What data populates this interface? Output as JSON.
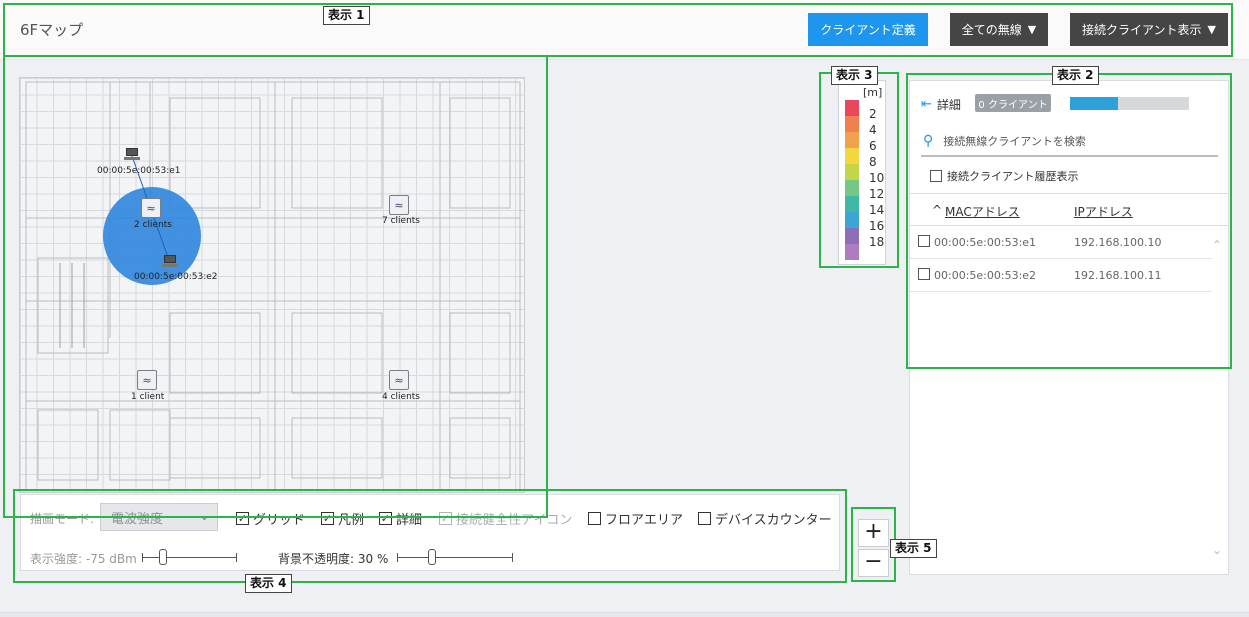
{
  "header": {
    "map_title": "6Fマップ",
    "client_define_button": "クライアント定義",
    "wireless_filter_button": "全ての無線",
    "client_display_button": "接続クライアント表示",
    "dropdown_caret": "▼"
  },
  "map": {
    "access_points": [
      {
        "label": "2 clients"
      },
      {
        "label": "7 clients"
      },
      {
        "label": "1 client"
      },
      {
        "label": "4 clients"
      }
    ],
    "clients": [
      {
        "mac": "00:00:5e:00:53:e1"
      },
      {
        "mac": "00:00:5e:00:53:e2"
      }
    ]
  },
  "legend": {
    "unit": "[m]",
    "entries": [
      {
        "value": "2",
        "color": "#e8475e"
      },
      {
        "value": "4",
        "color": "#f08050"
      },
      {
        "value": "6",
        "color": "#f2a24a"
      },
      {
        "value": "8",
        "color": "#f4d63e"
      },
      {
        "value": "10",
        "color": "#c3d64a"
      },
      {
        "value": "12",
        "color": "#74c784"
      },
      {
        "value": "14",
        "color": "#3fb9a6"
      },
      {
        "value": "16",
        "color": "#3ba6d6"
      },
      {
        "value": "18",
        "color": "#8c6fb8"
      },
      {
        "value": "",
        "color": "#b07cc0"
      }
    ]
  },
  "panel": {
    "detail_label": "詳細",
    "detail_icon": "collapse-left-icon",
    "client_count_badge": "0 クライアント",
    "usage_fraction": 0.4,
    "search_placeholder": "接続無線クライアントを検索",
    "history_label": "接続クライアント履歴表示",
    "columns": {
      "sort_indicator": "^",
      "mac": "MACアドレス",
      "ip": "IPアドレス"
    },
    "rows": [
      {
        "mac": "00:00:5e:00:53:e1",
        "ip": "192.168.100.10"
      },
      {
        "mac": "00:00:5e:00:53:e2",
        "ip": "192.168.100.11"
      }
    ]
  },
  "controls": {
    "draw_mode_label": "描画モード:",
    "draw_mode_value": "電波強度",
    "grid_label": "グリッド",
    "legend_label": "凡例",
    "detail_label": "詳細",
    "health_icon_label": "接続健全性アイコン",
    "floor_area_label": "フロアエリア",
    "device_counter_label": "デバイスカウンター",
    "check_mark": "✓",
    "display_strength_label": "表示強度: -75 dBm",
    "bg_opacity_label": "背景不透明度: 30 %",
    "display_strength_position": 0.22,
    "bg_opacity_position": 0.3
  },
  "zoom": {
    "in_label": "+",
    "out_label": "−"
  },
  "annotations": {
    "label_1": "表示 1",
    "label_2": "表示 2",
    "label_3": "表示 3",
    "label_4": "表示 4",
    "label_5": "表示 5",
    "color": "#2db34a"
  }
}
